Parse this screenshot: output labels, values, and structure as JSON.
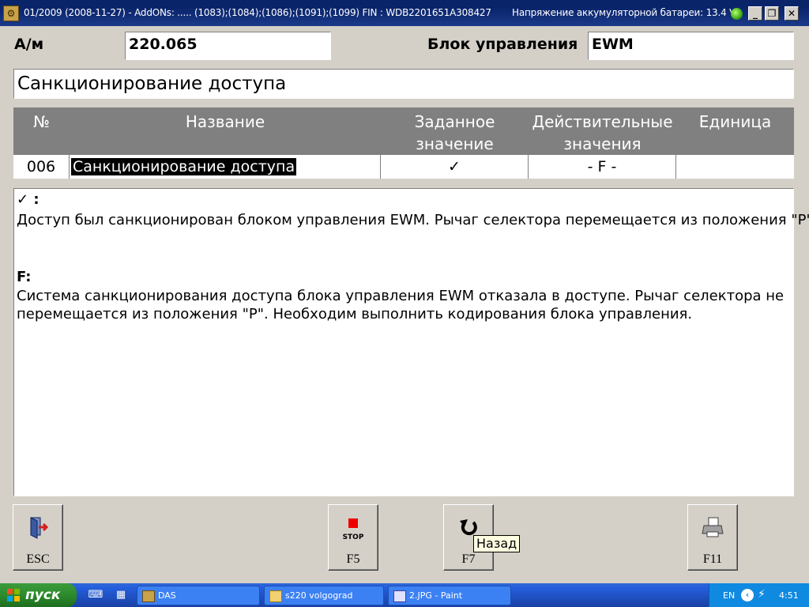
{
  "window": {
    "title": "01/2009 (2008-11-27) - AddONs: ..... (1083);(1084);(1086);(1091);(1099)  FIN : WDB2201651A308427",
    "battery_text": "Напряжение аккумуляторной батареи: 13.4 V",
    "min_label": "_",
    "max_label": "❐",
    "close_label": "✕"
  },
  "header": {
    "vehicle_label": "А/м",
    "vehicle_value": "220.065",
    "unit_label": "Блок управления",
    "unit_value": "EWM"
  },
  "section": {
    "title": "Санкционирование доступа"
  },
  "table": {
    "columns": {
      "number": "№",
      "name": "Название",
      "nominal_1": "Заданное",
      "nominal_2": "значение",
      "actual_1": "Действительные",
      "actual_2": "значения",
      "unit": "Единица"
    },
    "row": {
      "number": "006",
      "name": "Санкционирование доступа",
      "nominal": "✓",
      "actual": "- F -",
      "unit": ""
    }
  },
  "description": {
    "check_heading": "✓ :",
    "check_text": "Доступ был санкционирован блоком управления EWM. Рычаг селектора перемещается из положения \"P\".",
    "f_heading": "F:",
    "f_text_1": "Система санкционирования доступа блока управления EWM отказала в доступе. Рычаг селектора не",
    "f_text_2": "перемещается из положения \"P\". Необходим выполнить кодирования блока управления."
  },
  "buttons": {
    "esc": "ESC",
    "stop_caption": "STOP",
    "f5": "F5",
    "f7": "F7",
    "f11": "F11",
    "tooltip": "Назад"
  },
  "taskbar": {
    "start": "пуск",
    "tasks": [
      "DAS",
      "s220 volgograd",
      "2.JPG - Paint"
    ],
    "lang": "EN",
    "clock": "4:51"
  },
  "colors": {
    "titlebar": "#0a246a",
    "table_header": "#808080",
    "window_bg": "#d4d0c8",
    "taskbar": "#245edb",
    "start": "#2d8a2d",
    "stop_red": "#ee0000"
  }
}
